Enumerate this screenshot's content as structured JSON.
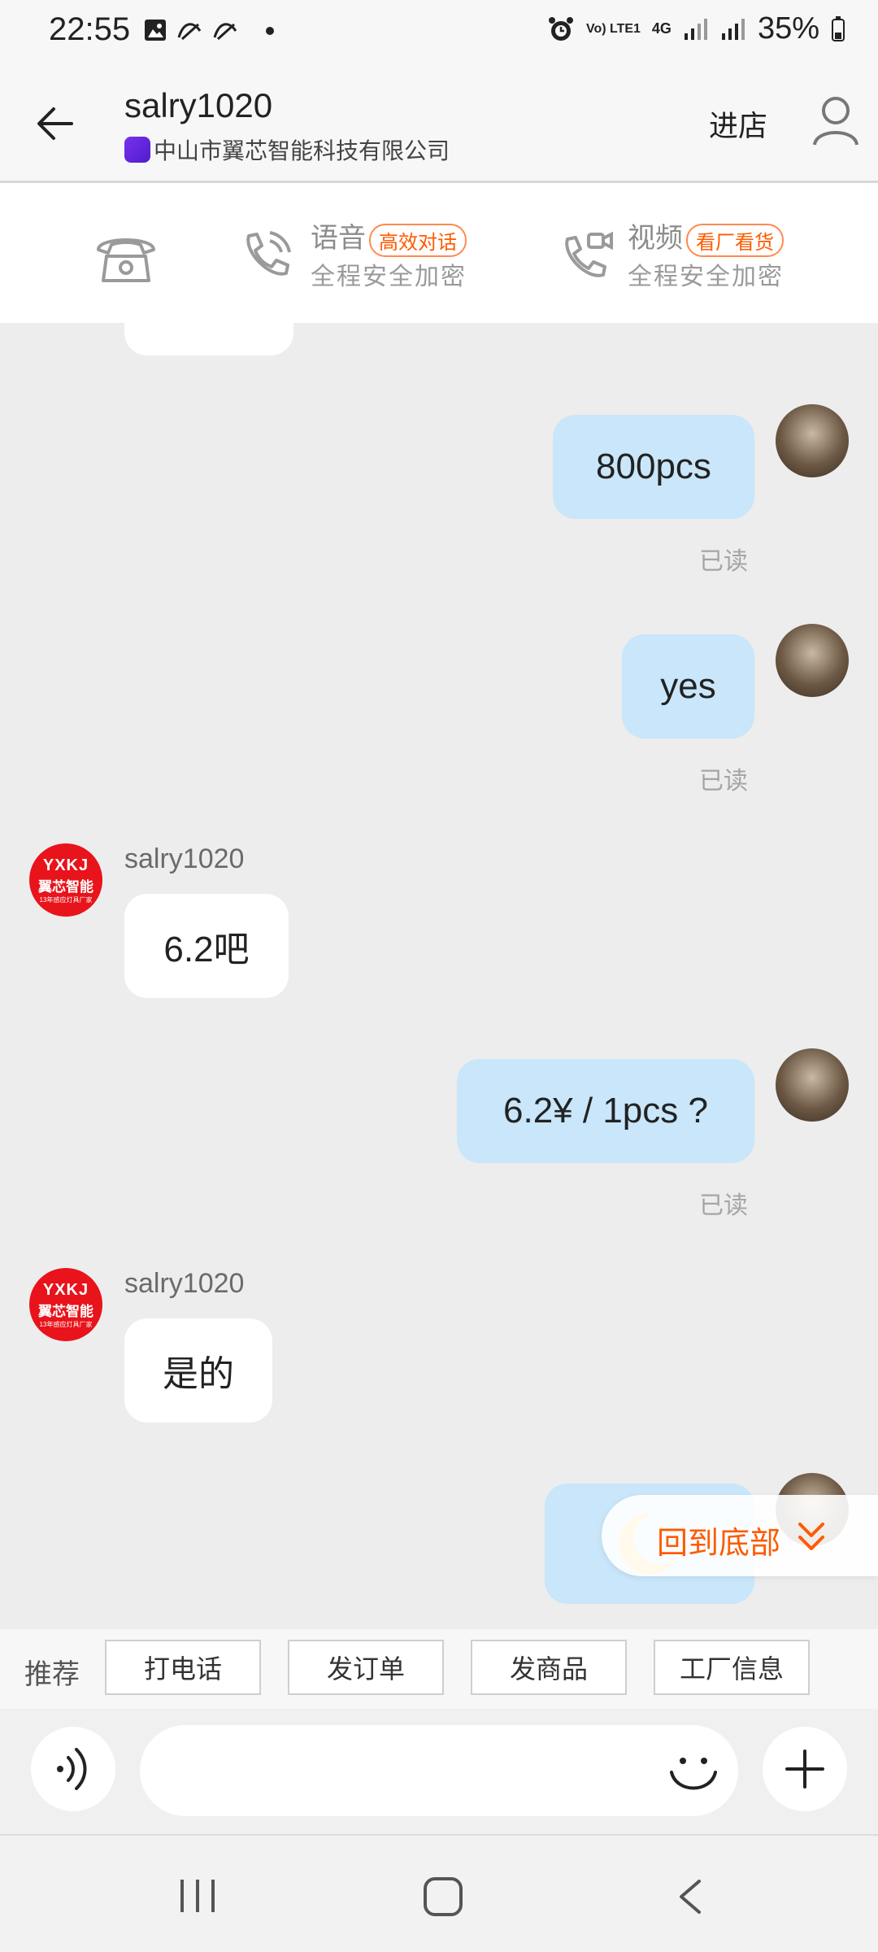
{
  "status_bar": {
    "time": "22:55",
    "network": "4G",
    "volte": "Vo) LTE1",
    "battery": "35%",
    "icons": [
      "image-icon",
      "notification-icon",
      "alarm-icon",
      "signal-icon",
      "battery-icon"
    ]
  },
  "header": {
    "title": "salry1020",
    "company": "中山市翼芯智能科技有限公司",
    "enter_shop": "进店"
  },
  "call_bar": {
    "voice_title": "语音",
    "voice_badge": "高效对话",
    "voice_sub": "全程安全加密",
    "video_title": "视频",
    "video_badge": "看厂看货",
    "video_sub": "全程安全加密"
  },
  "brand_avatar": {
    "line1": "YXKJ",
    "line2": "翼芯智能",
    "line3": "13年感应灯具厂家"
  },
  "messages": [
    {
      "from": "me",
      "text": "800pcs",
      "status": "已读"
    },
    {
      "from": "me",
      "text": "yes",
      "status": "已读"
    },
    {
      "from": "them",
      "sender": "salry1020",
      "text": "6.2吧"
    },
    {
      "from": "me",
      "text": "6.2¥ / 1pcs ?",
      "status": "已读"
    },
    {
      "from": "them",
      "sender": "salry1020",
      "text": "是的"
    },
    {
      "from": "me",
      "text": "emoji-moon"
    }
  ],
  "back_to_bottom": "回到底部",
  "recommend": {
    "label": "推荐",
    "buttons": [
      "打电话",
      "发订单",
      "发商品",
      "工厂信息"
    ]
  },
  "input": {
    "placeholder": ""
  },
  "colors": {
    "accent": "#ff5a00",
    "my_bubble": "#c9e6fa",
    "brand_red": "#e8131b"
  }
}
